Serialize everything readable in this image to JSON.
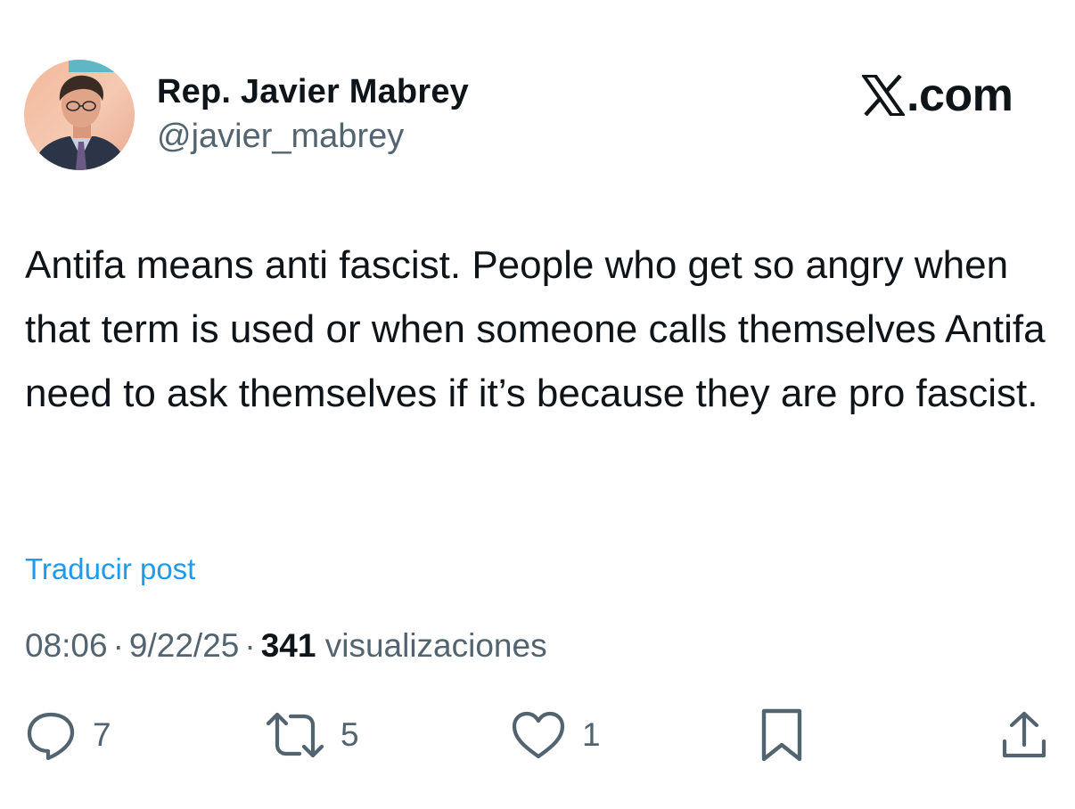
{
  "author": {
    "display_name": "Rep. Javier Mabrey",
    "handle": "@javier_mabrey",
    "avatar_icon": "profile-photo"
  },
  "brand": {
    "logo_icon": "x-logo-icon",
    "text": ".com"
  },
  "post": {
    "text": "Antifa means anti fascist. People who get so angry when that term is used or when someone calls themselves Antifa need to ask themselves if it’s because they are pro fascist.",
    "translate_label": "Traducir post"
  },
  "meta": {
    "time": "08:06",
    "separator": "·",
    "date": "9/22/25",
    "views_count": "341",
    "views_label": "visualizaciones"
  },
  "actions": {
    "replies": "7",
    "reposts": "5",
    "likes": "1"
  },
  "colors": {
    "text": "#0f1419",
    "secondary": "#536471",
    "link": "#1d9bf0",
    "background": "#ffffff"
  }
}
